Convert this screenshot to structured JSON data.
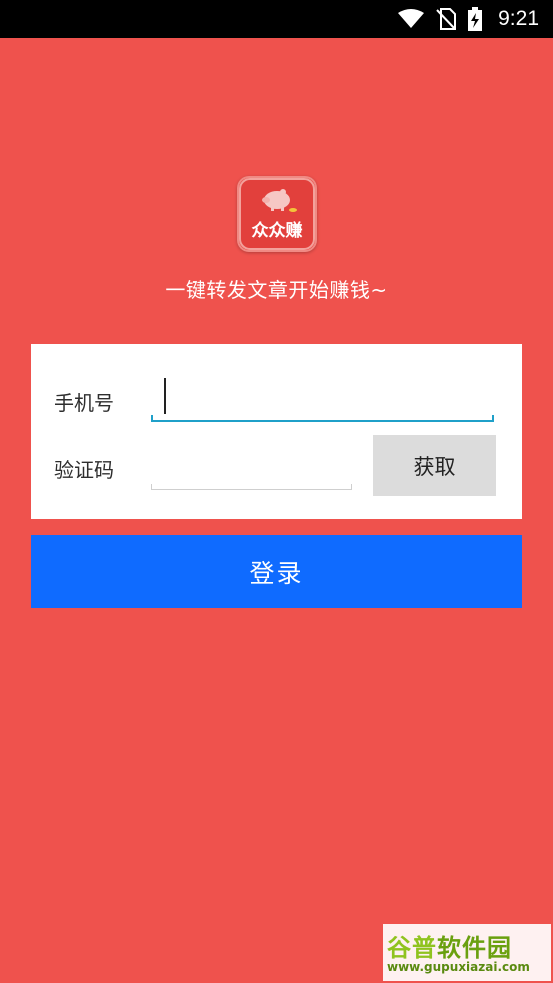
{
  "status_bar": {
    "time": "9:21"
  },
  "app": {
    "logo_text": "众众赚",
    "tagline": "一键转发文章开始赚钱~"
  },
  "form": {
    "phone_label": "手机号",
    "phone_value": "",
    "code_label": "验证码",
    "code_value": "",
    "get_code_label": "获取"
  },
  "login_label": "登录",
  "watermark": {
    "title_part1": "谷普",
    "title_part2": "软件园",
    "url": "www.gupuxiazai.com"
  },
  "colors": {
    "background": "#ef524d",
    "login_button": "#0f6bff",
    "active_underline": "#1fa0c9"
  }
}
